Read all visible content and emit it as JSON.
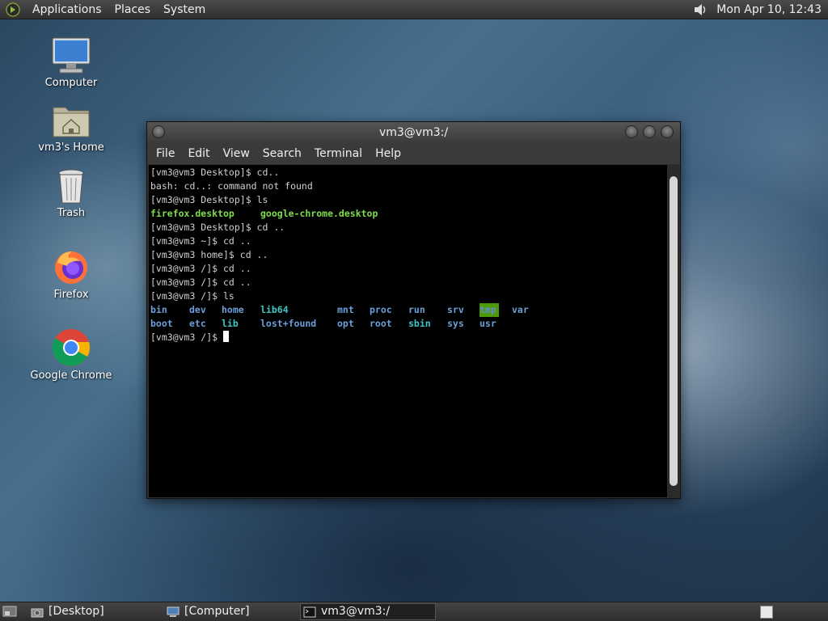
{
  "top_panel": {
    "menus": [
      "Applications",
      "Places",
      "System"
    ],
    "clock": "Mon Apr 10, 12:43"
  },
  "desktop_icons": {
    "computer": "Computer",
    "home": "vm3's Home",
    "trash": "Trash",
    "firefox": "Firefox",
    "chrome": "Google Chrome"
  },
  "terminal": {
    "title": "vm3@vm3:/",
    "menu": [
      "File",
      "Edit",
      "View",
      "Search",
      "Terminal",
      "Help"
    ],
    "lines": [
      "[vm3@vm3 Desktop]$ cd..",
      "bash: cd..: command not found",
      "[vm3@vm3 Desktop]$ ls"
    ],
    "ls_desktop": [
      "firefox.desktop",
      "google-chrome.desktop"
    ],
    "lines2": [
      "[vm3@vm3 Desktop]$ cd ..",
      "[vm3@vm3 ~]$ cd ..",
      "[vm3@vm3 home]$ cd ..",
      "[vm3@vm3 /]$ cd ..",
      "[vm3@vm3 /]$ cd ..",
      "[vm3@vm3 /]$ ls"
    ],
    "ls_root_row1": [
      "bin",
      "dev",
      "home",
      "lib64",
      "mnt",
      "proc",
      "run",
      "srv",
      "tmp",
      "var"
    ],
    "ls_root_row2": [
      "boot",
      "etc",
      "lib",
      "lost+found",
      "opt",
      "root",
      "sbin",
      "sys",
      "usr"
    ],
    "prompt": "[vm3@vm3 /]$ "
  },
  "bottom_panel": {
    "tasks": [
      "[Desktop]",
      "[Computer]",
      "vm3@vm3:/"
    ]
  }
}
